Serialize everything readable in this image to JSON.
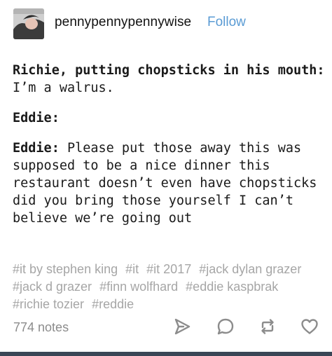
{
  "post": {
    "username": "pennypennypennywise",
    "follow_label": "Follow",
    "lines": [
      {
        "speaker": "Richie, putting chopsticks in his mouth:",
        "text": " I’m a walrus."
      },
      {
        "speaker": "Eddie:",
        "text": ""
      },
      {
        "speaker": "Eddie:",
        "text": " Please put those away this was supposed to be a nice dinner this restaurant doesn’t even have chopsticks did you bring those yourself I can’t believe we’re going out"
      }
    ],
    "tags": [
      "#it by stephen king",
      "#it",
      "#it 2017",
      "#jack dylan grazer",
      "#jack d grazer",
      "#finn wolfhard",
      "#eddie kaspbrak",
      "#richie tozier",
      "#reddie"
    ],
    "notes": "774 notes"
  },
  "icons": {
    "avatar": "user-avatar",
    "share": "share-icon",
    "reply": "reply-icon",
    "reblog": "reblog-icon",
    "like": "heart-icon"
  },
  "colors": {
    "follow": "#5a9bd4",
    "tags": "#a6a6a6",
    "icons": "#8c8c8c",
    "bottom_bar": "#3a4656"
  }
}
